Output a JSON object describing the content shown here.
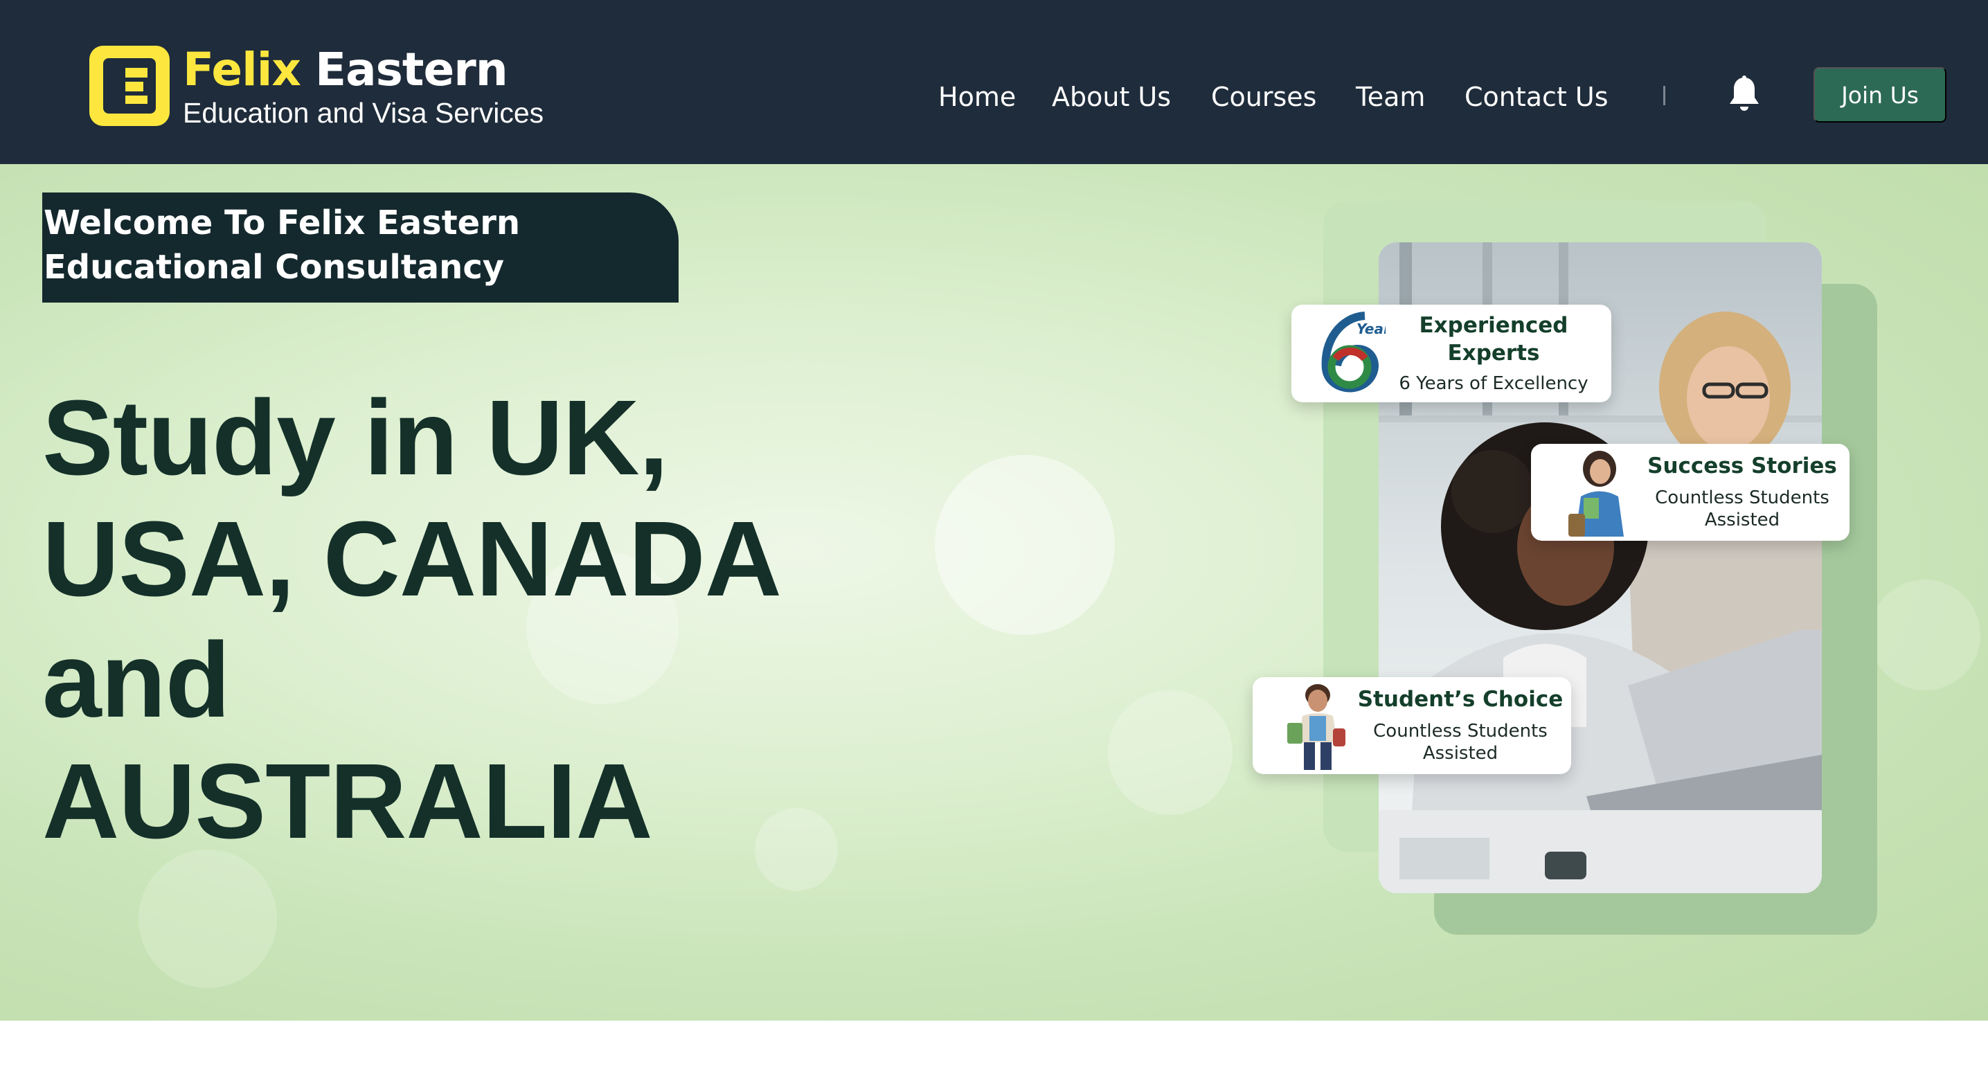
{
  "brand": {
    "name_part1": "Felix",
    "name_part2": "Eastern",
    "tagline": "Education and Visa Services",
    "logo_icon": "felix-eastern-logo",
    "colors": {
      "header_bg": "#1f2c3b",
      "accent_yellow": "#fde73f",
      "button_green": "#2d6a55"
    }
  },
  "nav": {
    "items": [
      {
        "label": "Home"
      },
      {
        "label": "About Us"
      },
      {
        "label": "Courses"
      },
      {
        "label": "Team"
      },
      {
        "label": "Contact Us"
      }
    ],
    "divider": "|",
    "notification_icon": "bell-icon",
    "join_label": "Join Us"
  },
  "hero": {
    "welcome": "Welcome To Felix Eastern Educational Consultancy",
    "headline_lines": [
      "Study in UK,",
      "USA, CANADA",
      "and",
      "AUSTRALIA"
    ],
    "cards": {
      "experience": {
        "badge": "Year",
        "title": "Experienced Experts",
        "text": "6 Years of Excellency"
      },
      "success": {
        "title": "Success Stories",
        "text": "Countless Students Assisted"
      },
      "choice": {
        "title": "Student’s Choice",
        "text": "Countless Students Assisted"
      }
    }
  }
}
